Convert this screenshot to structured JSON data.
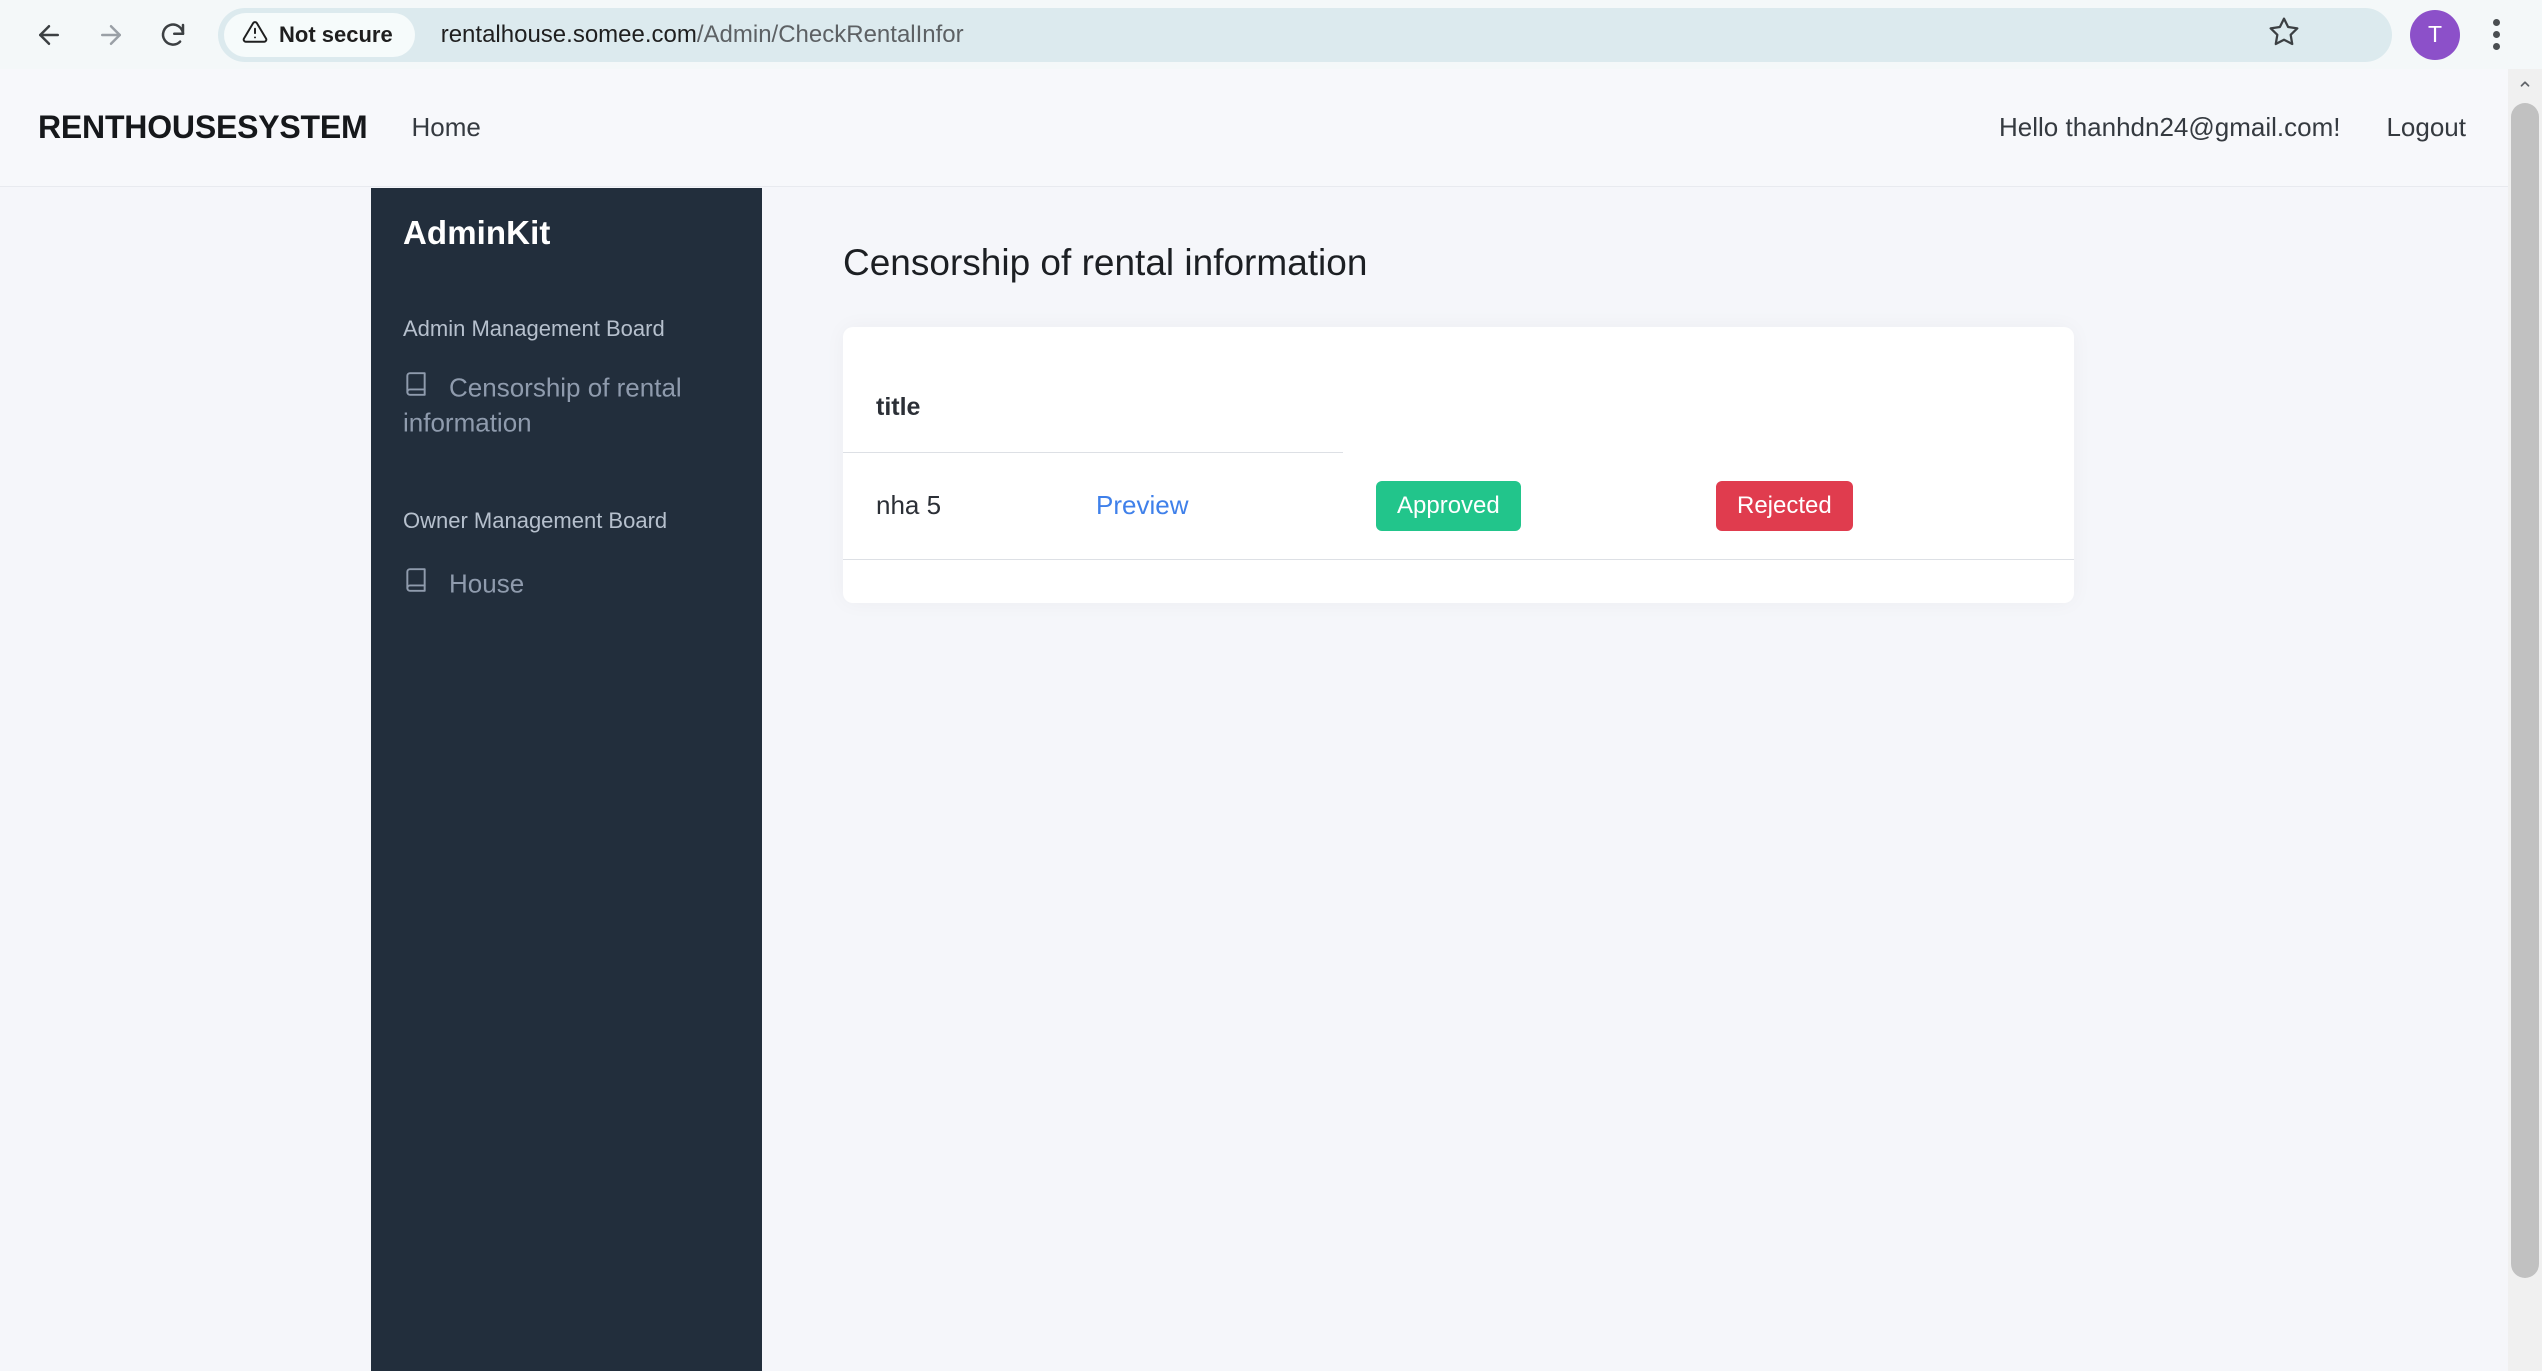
{
  "browser": {
    "back_icon": "back-arrow-icon",
    "forward_icon": "forward-arrow-icon",
    "reload_icon": "reload-icon",
    "security_label": "Not secure",
    "security_icon": "warning-triangle-icon",
    "url_host": "rentalhouse.somee.com",
    "url_path": "/Admin/CheckRentalInfor",
    "url_full": "rentalhouse.somee.com/Admin/CheckRentalInfor",
    "bookmark_icon": "star-icon",
    "profile_initial": "T",
    "menu_icon": "kebab-menu-icon"
  },
  "navbar": {
    "brand": "RENTHOUSESYSTEM",
    "home_label": "Home",
    "greeting": "Hello thanhdn24@gmail.com!",
    "logout_label": "Logout"
  },
  "sidebar": {
    "brand": "AdminKit",
    "sections": [
      {
        "title": "Admin Management Board",
        "items": [
          {
            "label": "Censorship of rental information",
            "icon": "book-icon"
          }
        ]
      },
      {
        "title": "Owner Management Board",
        "items": [
          {
            "label": "House",
            "icon": "book-icon"
          }
        ]
      }
    ]
  },
  "main": {
    "page_title": "Censorship of rental information",
    "table": {
      "headers": [
        "title",
        "",
        "",
        ""
      ],
      "rows": [
        {
          "title": "nha 5",
          "preview_label": "Preview",
          "approve_label": "Approved",
          "reject_label": "Rejected"
        }
      ]
    }
  },
  "colors": {
    "sidebar_bg": "#222e3c",
    "page_bg": "#f5f6fa",
    "approve_green": "#22c58b",
    "reject_red": "#e03c4e",
    "link_blue": "#3f80ea",
    "avatar_purple": "#8c50c9"
  }
}
